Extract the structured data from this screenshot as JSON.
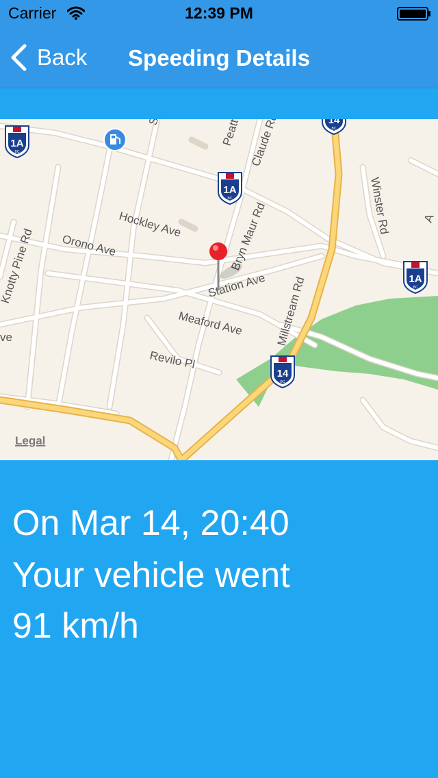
{
  "status_bar": {
    "carrier": "Carrier",
    "time": "12:39 PM",
    "wifi_icon": "wifi-icon",
    "battery_icon": "battery-icon"
  },
  "nav_bar": {
    "back_label": "Back",
    "title": "Speeding Details",
    "back_icon": "chevron-left-icon"
  },
  "map": {
    "legal_label": "Legal",
    "streets": {
      "hockley": "Hockley Ave",
      "orono": "Orono Ave",
      "knotty_pine": "Knotty Pine Rd",
      "bryn_mawr": "Bryn Maur Rd",
      "claude": "Claude Rd",
      "peatt": "Peatt",
      "station": "Station Ave",
      "meaford": "Meaford Ave",
      "revilo": "Revilo Pl",
      "millstream": "Millstream Rd",
      "winster": "Winster Rd",
      "partial_s": "S",
      "partial_a": "A",
      "partial_ve": "ve"
    },
    "shields": {
      "hwy_1a": "1A",
      "hwy_14": "14",
      "province": "BC"
    },
    "pin_icon": "map-pin-icon",
    "gas_icon": "gas-station-icon",
    "colors": {
      "land": "#f6f2ea",
      "road": "#ffffff",
      "highway": "#f8c85a",
      "park": "#8fcf8e",
      "pin": "#e8202a"
    }
  },
  "details": {
    "line_date": "On Mar 14, 20:40",
    "line_intro": "Your vehicle went",
    "line_speed": "91 km/h"
  },
  "colors": {
    "nav_background": "#3498e8",
    "content_background": "#21a6f2",
    "text": "#ffffff"
  }
}
